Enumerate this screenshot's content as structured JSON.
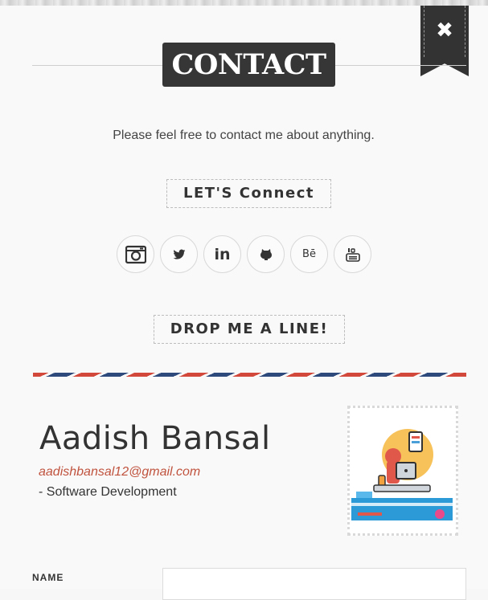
{
  "header": {
    "title": "CONTACT",
    "close_symbol": "✖"
  },
  "intro": "Please feel free to contact me about anything.",
  "connect": {
    "label": "LET'S Connect",
    "socials": [
      {
        "icon": "instagram-icon"
      },
      {
        "icon": "twitter-icon"
      },
      {
        "icon": "linkedin-icon",
        "glyph": "in"
      },
      {
        "icon": "github-icon"
      },
      {
        "icon": "behance-icon",
        "glyph": "Bē"
      },
      {
        "icon": "youtube-icon"
      }
    ]
  },
  "drop": {
    "label": "DROP ME A LINE!"
  },
  "card": {
    "name": "Aadish Bansal",
    "email": "aadishbansal12@gmail.com",
    "role": "- Software Development",
    "stamp_icon": "developer-illustration-stamp"
  },
  "form": {
    "name_label": "NAME"
  },
  "colors": {
    "title_bg": "#363636",
    "email": "#c0533e",
    "airmail_red": "#d2483a",
    "airmail_blue": "#2e4a7c"
  }
}
